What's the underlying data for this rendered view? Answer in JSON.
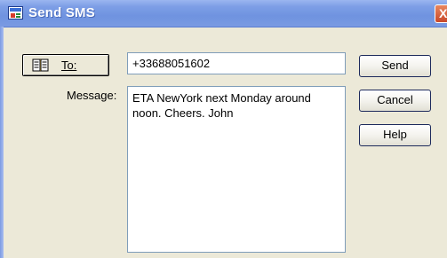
{
  "window": {
    "title": "Send SMS",
    "close_label": "X"
  },
  "to_button": {
    "icon": "address-book-icon",
    "label_underlined": "T",
    "label_rest": "o:"
  },
  "to_field": {
    "value": "+33688051602"
  },
  "message": {
    "label": "Message:",
    "value": "ETA NewYork next Monday around noon. Cheers. John"
  },
  "buttons": {
    "send": "Send",
    "cancel": "Cancel",
    "help": "Help"
  },
  "colors": {
    "titlebar": "#7a9ae2",
    "dialog_bg": "#ece9d8",
    "field_border": "#7f9db9"
  }
}
